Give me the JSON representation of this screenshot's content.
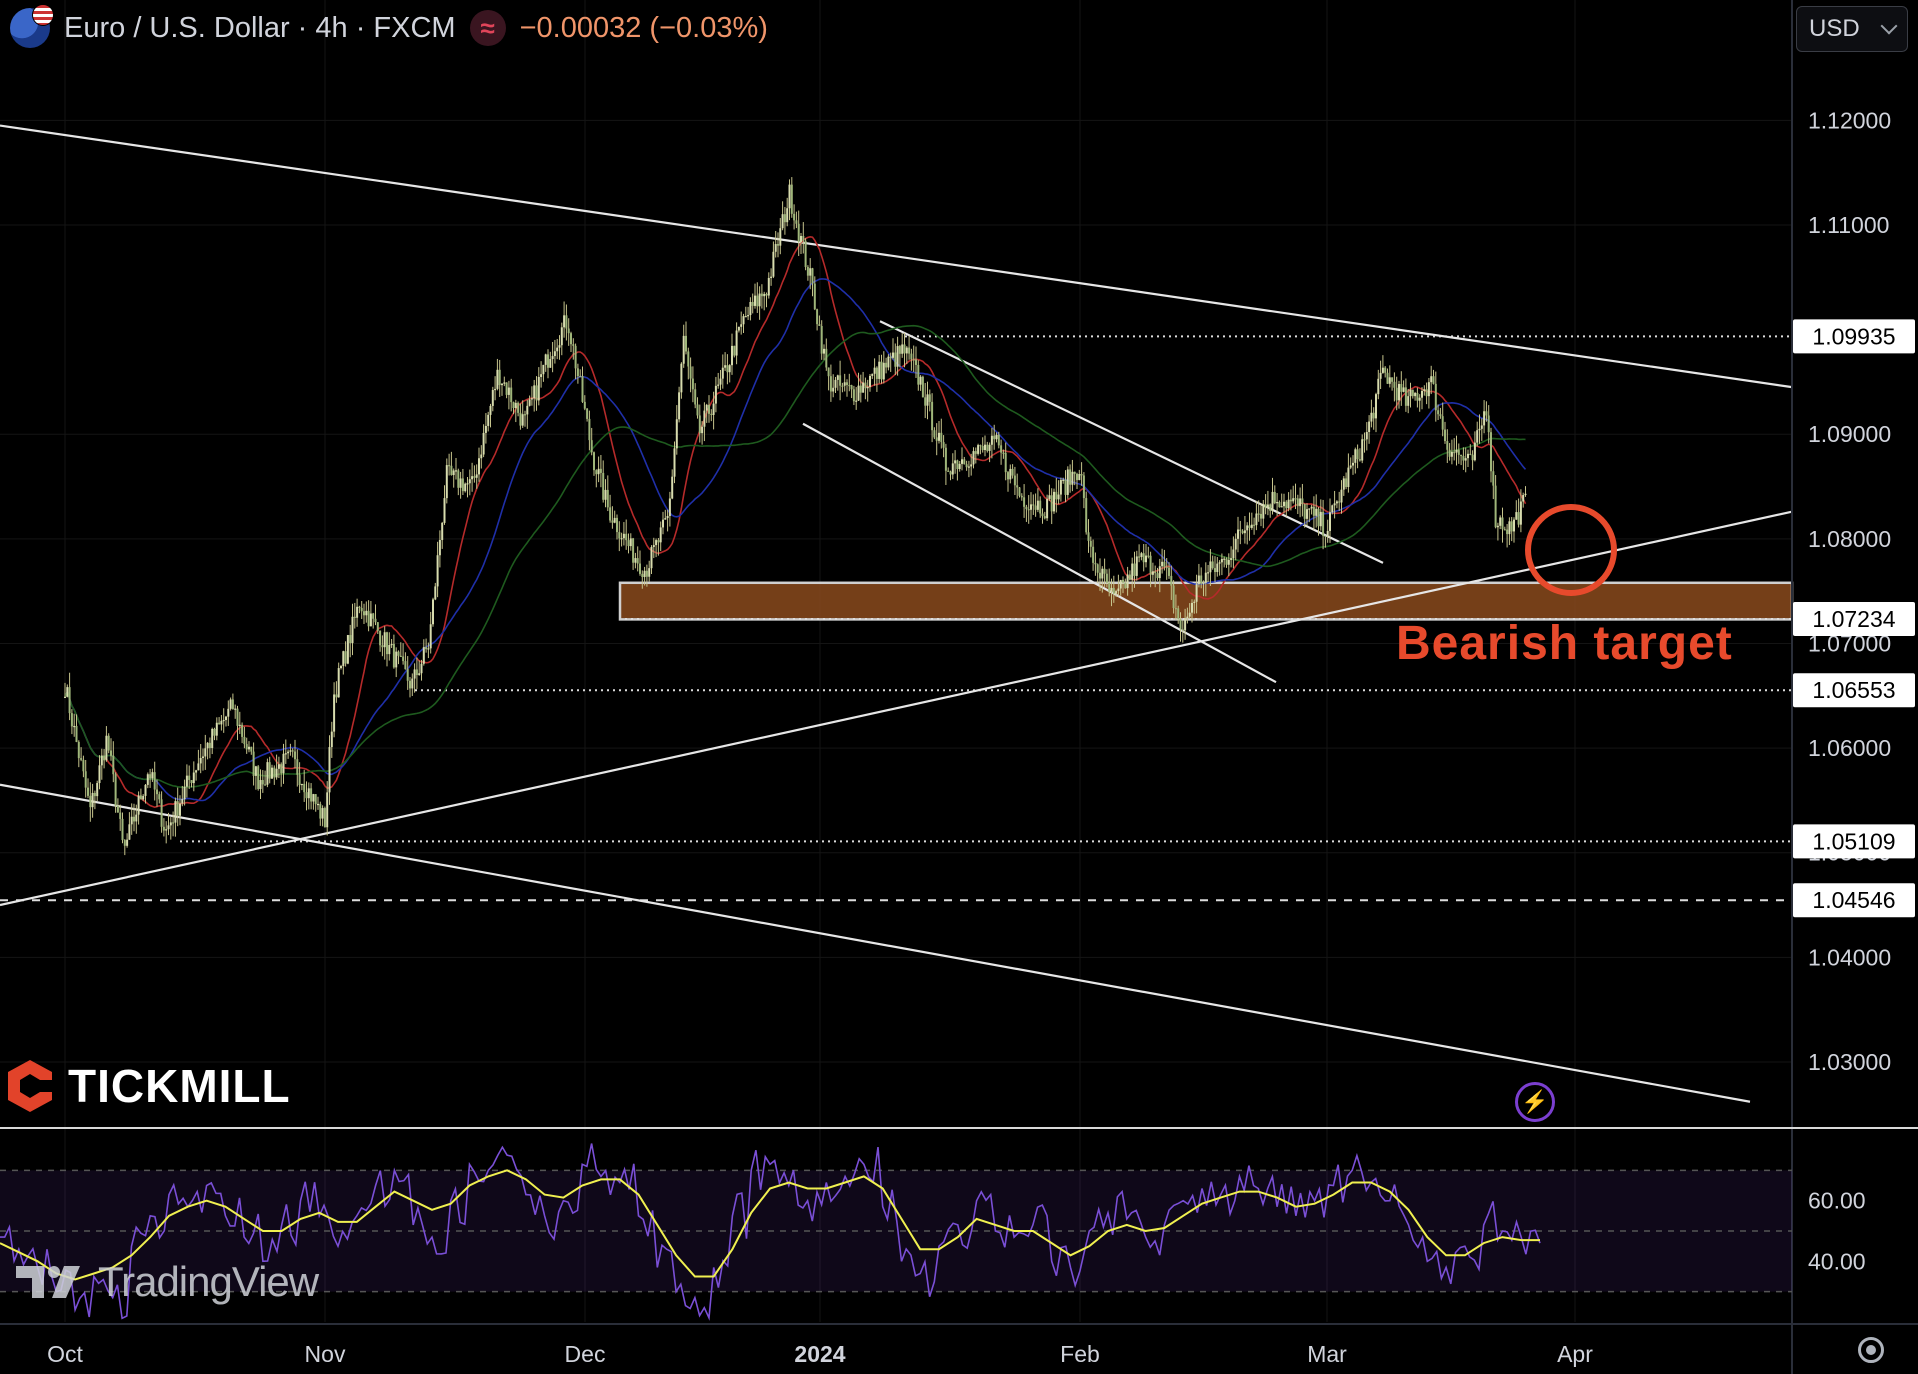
{
  "header": {
    "symbol": "Euro / U.S. Dollar · 4h · FXCM",
    "live_glyph": "≈",
    "change": "−0.00032 (−0.03%)"
  },
  "currency_button": {
    "label": "USD"
  },
  "branding": {
    "broker": "TICKMILL",
    "platform": "TradingView"
  },
  "annotation": {
    "text": "Bearish target"
  },
  "colors": {
    "background": "#000000",
    "candle": "#c6c48c",
    "ma_fast": "#b52a2a",
    "ma_mid": "#1f2fa8",
    "ma_slow": "#1e5a1e",
    "rsi": "#7a4fd6",
    "rsi_ma": "#f0f050",
    "zone": "#8a4a1c",
    "annotation": "#e74a2c",
    "price_tag_bg": "#ffffff"
  },
  "chart_data": [
    {
      "type": "candlestick",
      "title": "Euro / U.S. Dollar · 4h · FXCM",
      "x_ticks": [
        "Oct",
        "Nov",
        "Dec",
        "2024",
        "Feb",
        "Mar",
        "Apr"
      ],
      "y_ticks": [
        "1.12000",
        "1.11000",
        "1.09000",
        "1.08000",
        "1.07000",
        "1.06000",
        "1.05000",
        "1.04000",
        "1.03000"
      ],
      "ylim": [
        1.0235,
        1.1315
      ],
      "price_levels": [
        "1.09935",
        "1.07234",
        "1.06553",
        "1.05109",
        "1.04546"
      ],
      "support_zone": [
        1.0723,
        1.0758
      ],
      "price_path": [
        [
          "Oct 1",
          1.066
        ],
        [
          "Oct 4",
          1.054
        ],
        [
          "Oct 6",
          1.061
        ],
        [
          "Oct 8",
          1.05
        ],
        [
          "Oct 11",
          1.058
        ],
        [
          "Oct 13",
          1.052
        ],
        [
          "Oct 17",
          1.059
        ],
        [
          "Oct 21",
          1.064
        ],
        [
          "Oct 24",
          1.057
        ],
        [
          "Oct 28",
          1.059
        ],
        [
          "Nov 1",
          1.053
        ],
        [
          "Nov 2",
          1.065
        ],
        [
          "Nov 5",
          1.074
        ],
        [
          "Nov 8",
          1.07
        ],
        [
          "Nov 11",
          1.066
        ],
        [
          "Nov 13",
          1.07
        ],
        [
          "Nov 15",
          1.086
        ],
        [
          "Nov 18",
          1.085
        ],
        [
          "Nov 21",
          1.096
        ],
        [
          "Nov 24",
          1.091
        ],
        [
          "Nov 27",
          1.098
        ],
        [
          "Nov 29",
          1.101
        ],
        [
          "Dec 2",
          1.088
        ],
        [
          "Dec 4",
          1.083
        ],
        [
          "Dec 7",
          1.079
        ],
        [
          "Dec 9",
          1.077
        ],
        [
          "Dec 12",
          1.082
        ],
        [
          "Dec 14",
          1.099
        ],
        [
          "Dec 16",
          1.09
        ],
        [
          "Dec 19",
          1.095
        ],
        [
          "Dec 22",
          1.101
        ],
        [
          "Dec 25",
          1.104
        ],
        [
          "Dec 28",
          1.113
        ],
        [
          "Dec 31",
          1.104
        ],
        [
          "Jan 2",
          1.095
        ],
        [
          "Jan 5",
          1.094
        ],
        [
          "Jan 8",
          1.096
        ],
        [
          "Jan 11",
          1.098
        ],
        [
          "Jan 13",
          1.095
        ],
        [
          "Jan 16",
          1.087
        ],
        [
          "Jan 19",
          1.088
        ],
        [
          "Jan 22",
          1.089
        ],
        [
          "Jan 25",
          1.084
        ],
        [
          "Jan 28",
          1.083
        ],
        [
          "Feb 1",
          1.087
        ],
        [
          "Feb 2",
          1.079
        ],
        [
          "Feb 5",
          1.074
        ],
        [
          "Feb 8",
          1.078
        ],
        [
          "Feb 11",
          1.077
        ],
        [
          "Feb 13",
          1.071
        ],
        [
          "Feb 15",
          1.076
        ],
        [
          "Feb 18",
          1.078
        ],
        [
          "Feb 21",
          1.082
        ],
        [
          "Feb 24",
          1.084
        ],
        [
          "Feb 27",
          1.083
        ],
        [
          "Mar 1",
          1.081
        ],
        [
          "Mar 3",
          1.085
        ],
        [
          "Mar 6",
          1.09
        ],
        [
          "Mar 8",
          1.096
        ],
        [
          "Mar 11",
          1.093
        ],
        [
          "Mar 14",
          1.095
        ],
        [
          "Mar 16",
          1.089
        ],
        [
          "Mar 19",
          1.087
        ],
        [
          "Mar 21",
          1.093
        ],
        [
          "Mar 22",
          1.082
        ],
        [
          "Mar 24",
          1.081
        ],
        [
          "Mar 26",
          1.084
        ]
      ],
      "moving_averages": [
        "fast",
        "mid",
        "slow"
      ]
    },
    {
      "type": "line",
      "y_ticks": [
        "60.00",
        "40.00"
      ],
      "ylim": [
        20,
        80
      ],
      "bands": [
        70,
        50,
        30
      ],
      "series": [
        {
          "values": [
            48,
            44,
            38,
            30,
            24,
            35,
            28,
            45,
            55,
            62,
            58,
            65,
            55,
            48,
            40,
            52,
            60,
            55,
            45,
            55,
            65,
            70,
            52,
            48,
            60,
            72,
            70,
            75,
            62,
            55,
            60,
            72,
            68,
            66,
            55,
            38,
            30,
            28,
            38,
            55,
            70,
            72,
            65,
            60,
            66,
            68,
            72,
            58,
            40,
            36,
            45,
            52,
            60,
            50,
            48,
            52,
            40,
            38,
            50,
            56,
            54,
            48,
            52,
            60,
            64,
            62,
            68,
            64,
            58,
            55,
            60,
            65,
            70,
            66,
            60,
            52,
            40,
            38,
            45,
            52,
            50,
            48,
            46
          ]
        },
        {
          "values": [
            46,
            43,
            40,
            36,
            34,
            36,
            38,
            42,
            48,
            55,
            58,
            60,
            58,
            54,
            50,
            50,
            54,
            56,
            53,
            53,
            58,
            63,
            60,
            57,
            59,
            65,
            68,
            70,
            67,
            62,
            61,
            65,
            67,
            67,
            62,
            52,
            42,
            35,
            35,
            44,
            56,
            64,
            66,
            64,
            64,
            66,
            68,
            64,
            54,
            44,
            44,
            48,
            54,
            52,
            50,
            50,
            46,
            42,
            45,
            50,
            52,
            50,
            51,
            55,
            59,
            61,
            63,
            63,
            61,
            58,
            59,
            62,
            66,
            66,
            63,
            57,
            48,
            42,
            42,
            46,
            48,
            47,
            47
          ]
        }
      ]
    }
  ]
}
